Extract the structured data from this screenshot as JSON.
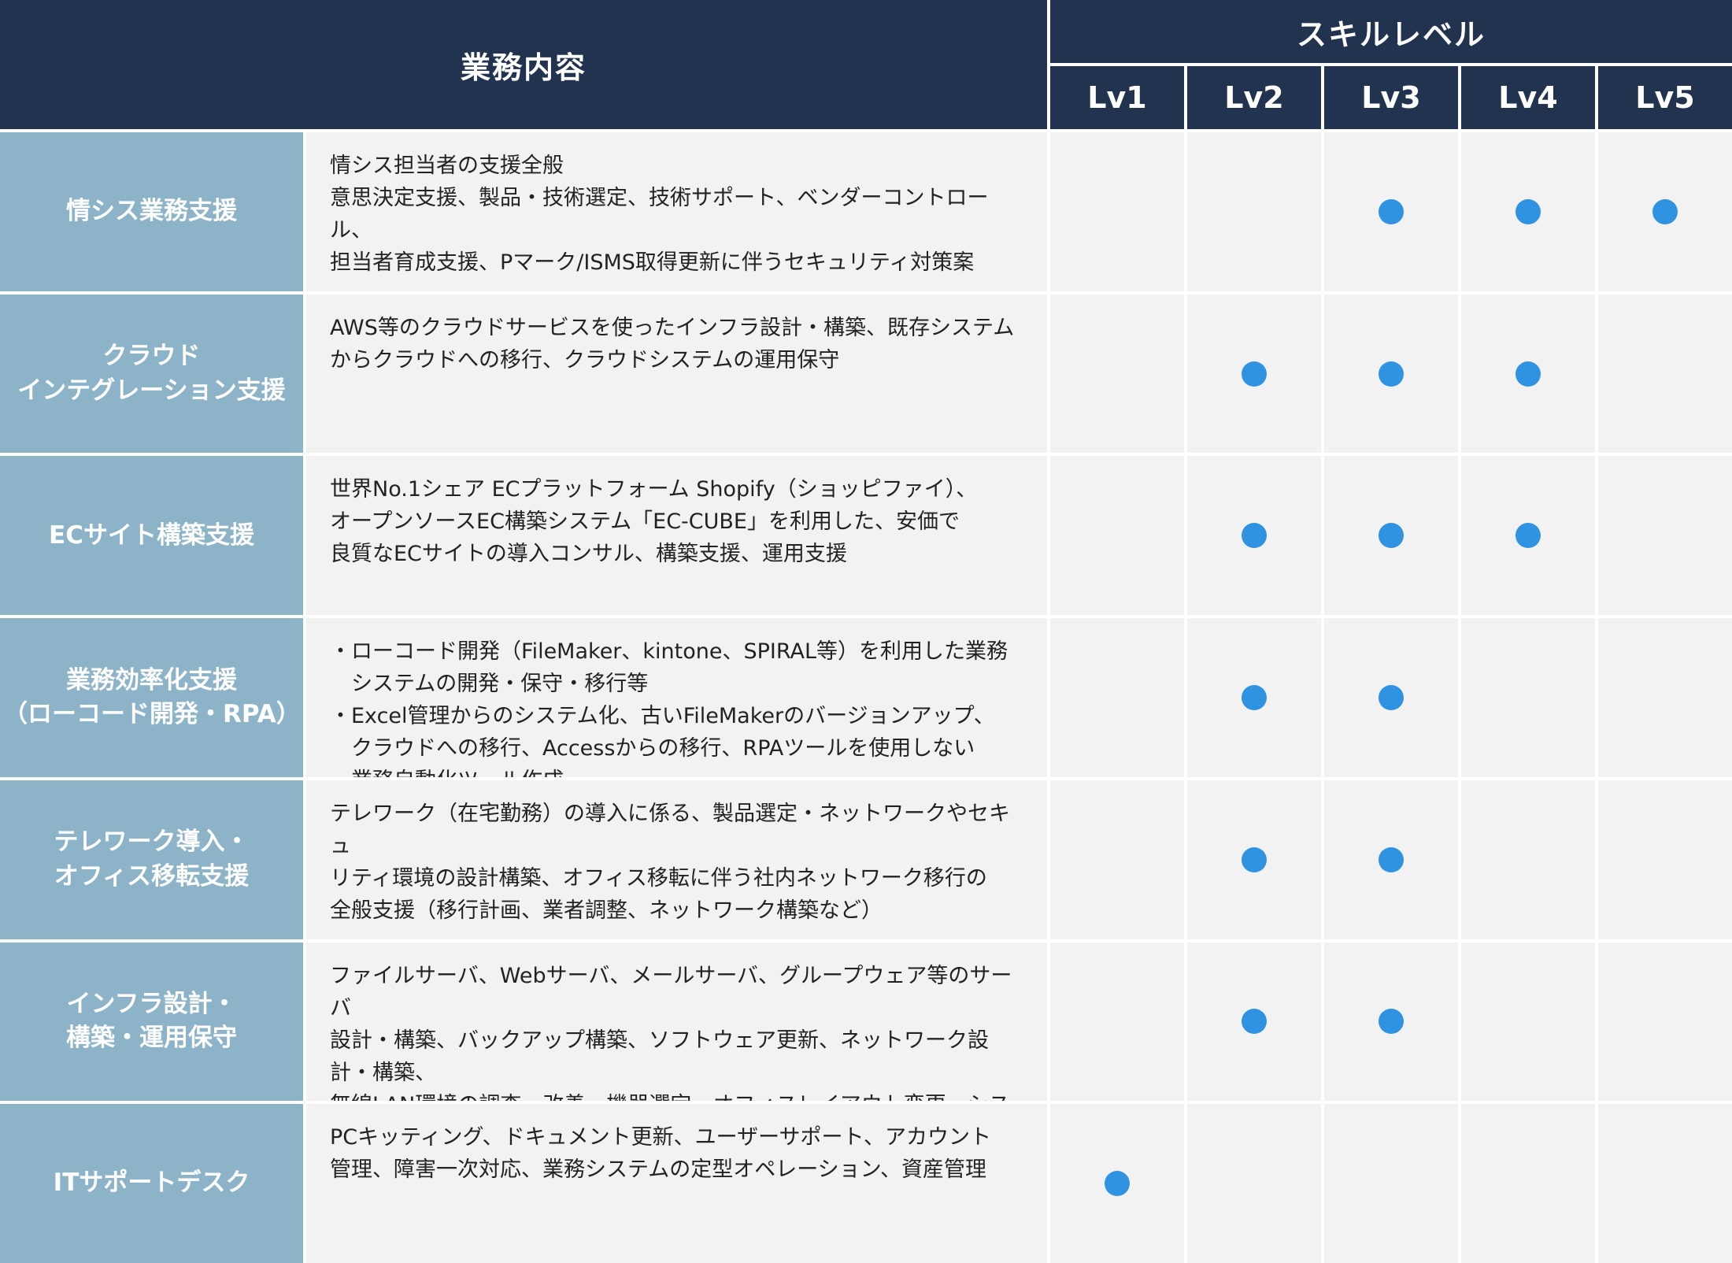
{
  "header": {
    "main": "業務内容",
    "skill": "スキルレベル",
    "levels": [
      "Lv1",
      "Lv2",
      "Lv3",
      "Lv4",
      "Lv5"
    ]
  },
  "colors": {
    "header_bg": "#22334f",
    "category_bg": "#8db3c8",
    "cell_bg": "#f2f2f2",
    "dot": "#2f93e2"
  },
  "rows": [
    {
      "category": "情シス業務支援",
      "description": "情シス担当者の支援全般\n意思決定支援、製品・技術選定、技術サポート、ベンダーコントロール、\n担当者育成支援、Pマーク/ISMS取得更新に伴うセキュリティ対策案",
      "levels": [
        false,
        false,
        true,
        true,
        true
      ]
    },
    {
      "category": "クラウド\nインテグレーション支援",
      "description": "AWS等のクラウドサービスを使ったインフラ設計・構築、既存システム\nからクラウドへの移行、クラウドシステムの運用保守",
      "levels": [
        false,
        true,
        true,
        true,
        false
      ]
    },
    {
      "category": "ECサイト構築支援",
      "description": "世界No.1シェア ECプラットフォーム Shopify（ショッピファイ）、\nオープンソースEC構築システム「EC-CUBE」を利用した、安価で\n良質なECサイトの導入コンサル、構築支援、運用支援",
      "levels": [
        false,
        true,
        true,
        true,
        false
      ]
    },
    {
      "category": "業務効率化支援\n（ローコード開発・RPA）",
      "description": "・ローコード開発（FileMaker、kintone、SPIRAL等）を利用した業務\n　システムの開発・保守・移行等\n・Excel管理からのシステム化、古いFileMakerのバージョンアップ、\n　クラウドへの移行、Accessからの移行、RPAツールを使用しない\n　業務自動化ツール作成",
      "levels": [
        false,
        true,
        true,
        false,
        false
      ]
    },
    {
      "category": "テレワーク導入・\nオフィス移転支援",
      "description": "テレワーク（在宅勤務）の導入に係る、製品選定・ネットワークやセキュ\nリティ環境の設計構築、オフィス移転に伴う社内ネットワーク移行の\n全般支援（移行計画、業者調整、ネットワーク構築など）",
      "levels": [
        false,
        true,
        true,
        false,
        false
      ]
    },
    {
      "category": "インフラ設計・\n構築・運用保守",
      "description": "ファイルサーバ、Webサーバ、メールサーバ、グループウェア等のサーバ\n設計・構築、バックアップ構築、ソフトウェア更新、ネットワーク設計・構築、\n無線LAN環境の調査・改善、機器選定、オフィスレイアウト変更、システム\n運用改善、障害調査・対応",
      "levels": [
        false,
        true,
        true,
        false,
        false
      ]
    },
    {
      "category": "ITサポートデスク",
      "description": "PCキッティング、ドキュメント更新、ユーザーサポート、アカウント\n管理、障害一次対応、業務システムの定型オペレーション、資産管理",
      "levels": [
        true,
        false,
        false,
        false,
        false
      ]
    }
  ]
}
